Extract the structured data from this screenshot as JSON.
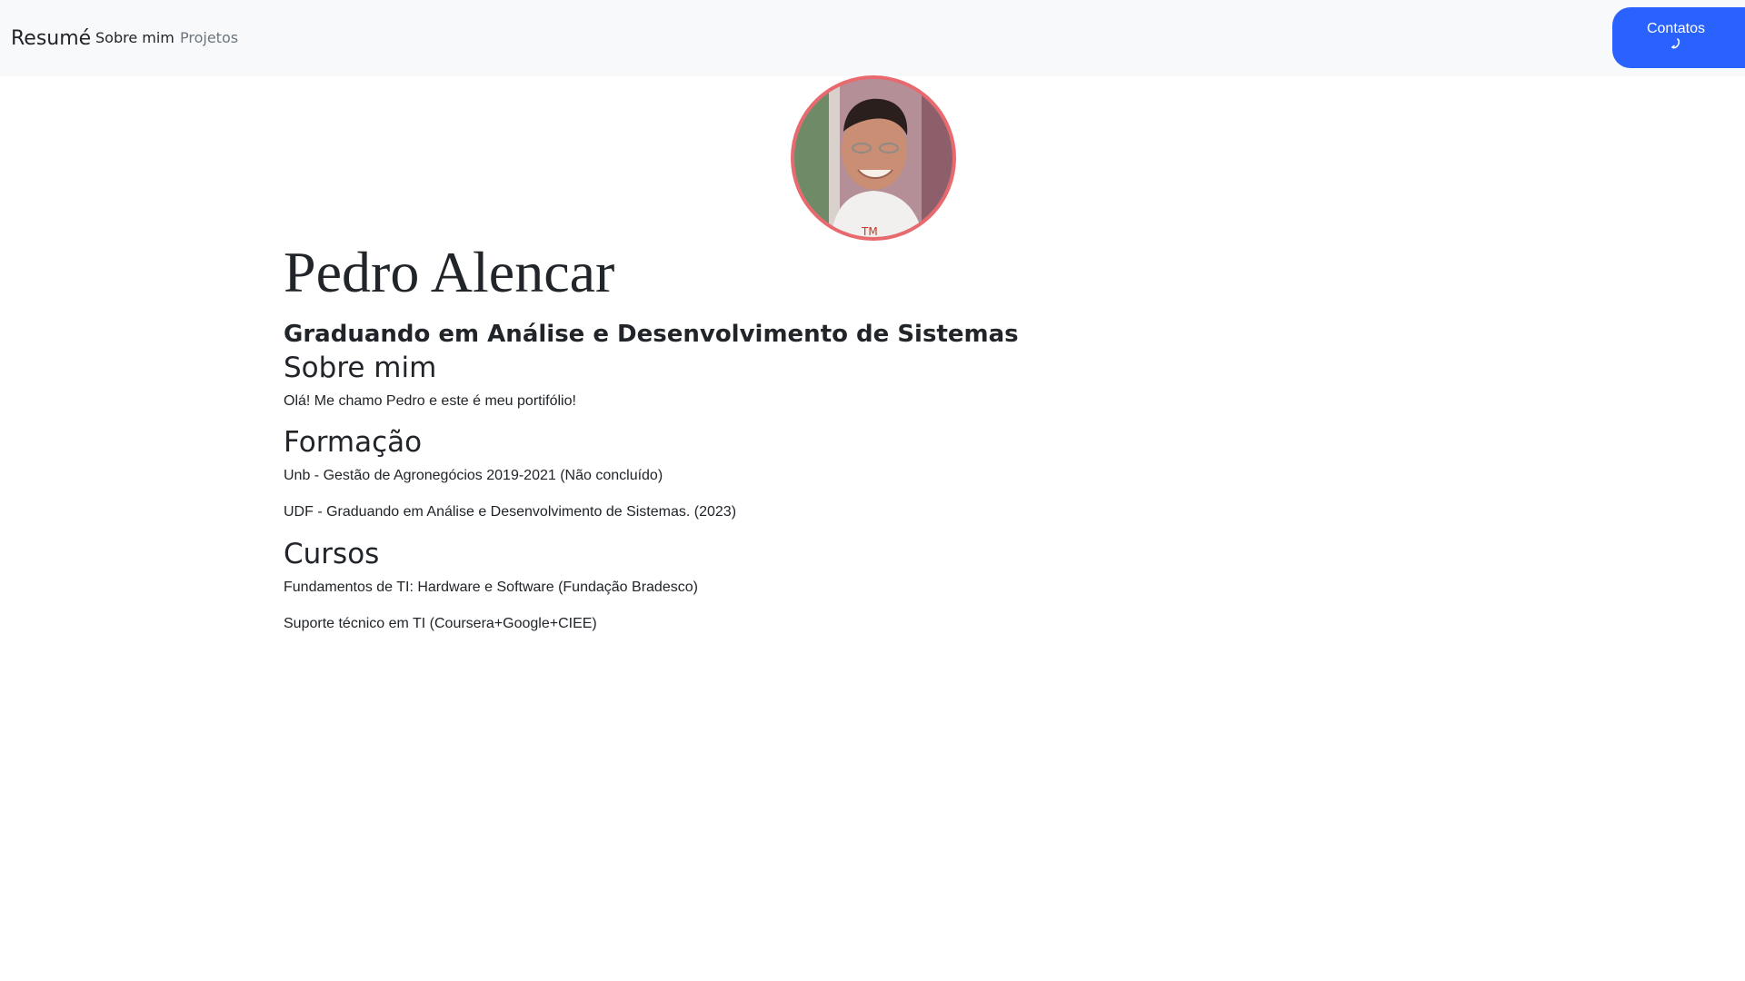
{
  "navbar": {
    "brand": "Resumé",
    "links": [
      {
        "label": "Sobre mim"
      },
      {
        "label": "Projetos"
      }
    ],
    "contact_button": {
      "label": "Contatos",
      "color": "#2962ff",
      "icon": "phone-icon"
    }
  },
  "profile": {
    "avatar_border_color": "#e8696e",
    "name": "Pedro Alencar",
    "subtitle": "Graduando em Análise e Desenvolvimento de Sistemas"
  },
  "about": {
    "title": "Sobre mim",
    "text": "Olá! Me chamo Pedro e este é meu portifólio!"
  },
  "education": {
    "title": "Formação",
    "items": [
      "Unb - Gestão de Agronegócios 2019-2021 (Não concluído)",
      "UDF - Graduando em Análise e Desenvolvimento de Sistemas. (2023)"
    ]
  },
  "courses": {
    "title": "Cursos",
    "items": [
      "Fundamentos de TI: Hardware e Software (Fundação Bradesco)",
      "Suporte técnico em TI (Coursera+Google+CIEE)"
    ]
  }
}
